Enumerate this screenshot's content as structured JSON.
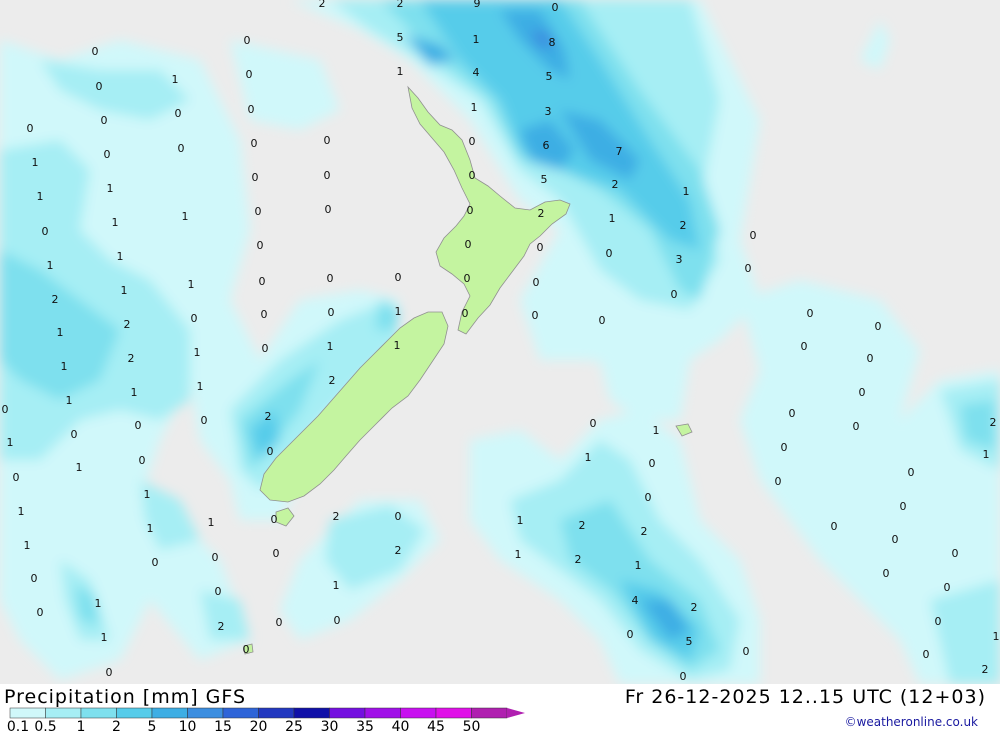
{
  "header": {
    "title": "Precipitation [mm] GFS",
    "datetime": "Fr 26-12-2025 12..15 UTC (12+03)"
  },
  "legend": {
    "ticks": [
      "0.1",
      "0.5",
      "1",
      "2",
      "5",
      "10",
      "15",
      "20",
      "25",
      "30",
      "35",
      "40",
      "45",
      "50"
    ],
    "colors": [
      "#d0f8fa",
      "#a6eef4",
      "#7ee0ee",
      "#56ccea",
      "#3eaee4",
      "#3c8ee0",
      "#2e64d8",
      "#2238c0",
      "#1010a8",
      "#7410e0",
      "#a010e8",
      "#c810f0",
      "#e010e8",
      "#b020b0"
    ]
  },
  "credit": "©weatheronline.co.uk",
  "map": {
    "colors": {
      "sea": "#ececec",
      "land": "#c4f4a0",
      "coast": "#909090"
    },
    "values": [
      [
        "2",
        322,
        3
      ],
      [
        "2",
        400,
        3
      ],
      [
        "9",
        477,
        3
      ],
      [
        "0",
        555,
        7
      ],
      [
        "0",
        95,
        51
      ],
      [
        "0",
        247,
        40
      ],
      [
        "5",
        400,
        37
      ],
      [
        "1",
        476,
        39
      ],
      [
        "8",
        552,
        42
      ],
      [
        "1",
        175,
        79
      ],
      [
        "0",
        249,
        74
      ],
      [
        "1",
        400,
        71
      ],
      [
        "4",
        476,
        72
      ],
      [
        "5",
        549,
        76
      ],
      [
        "0",
        99,
        86
      ],
      [
        "0",
        178,
        113
      ],
      [
        "0",
        251,
        109
      ],
      [
        "1",
        474,
        107
      ],
      [
        "3",
        548,
        111
      ],
      [
        "0",
        104,
        120
      ],
      [
        "0",
        30,
        128
      ],
      [
        "0",
        181,
        148
      ],
      [
        "0",
        254,
        143
      ],
      [
        "0",
        327,
        140
      ],
      [
        "0",
        472,
        141
      ],
      [
        "6",
        546,
        145
      ],
      [
        "7",
        619,
        151
      ],
      [
        "0",
        107,
        154
      ],
      [
        "1",
        35,
        162
      ],
      [
        "0",
        255,
        177
      ],
      [
        "0",
        327,
        175
      ],
      [
        "0",
        472,
        175
      ],
      [
        "5",
        544,
        179
      ],
      [
        "2",
        615,
        184
      ],
      [
        "1",
        110,
        188
      ],
      [
        "1",
        40,
        196
      ],
      [
        "0",
        258,
        211
      ],
      [
        "0",
        328,
        209
      ],
      [
        "0",
        470,
        210
      ],
      [
        "2",
        541,
        213
      ],
      [
        "1",
        612,
        218
      ],
      [
        "1",
        686,
        191
      ],
      [
        "1",
        185,
        216
      ],
      [
        "1",
        115,
        222
      ],
      [
        "0",
        45,
        231
      ],
      [
        "2",
        683,
        225
      ],
      [
        "0",
        753,
        235
      ],
      [
        "0",
        260,
        245
      ],
      [
        "0",
        468,
        244
      ],
      [
        "0",
        540,
        247
      ],
      [
        "0",
        609,
        253
      ],
      [
        "3",
        679,
        259
      ],
      [
        "0",
        748,
        268
      ],
      [
        "1",
        120,
        256
      ],
      [
        "1",
        50,
        265
      ],
      [
        "0",
        398,
        277
      ],
      [
        "0",
        330,
        278
      ],
      [
        "0",
        262,
        281
      ],
      [
        "0",
        467,
        278
      ],
      [
        "0",
        536,
        282
      ],
      [
        "1",
        191,
        284
      ],
      [
        "1",
        124,
        290
      ],
      [
        "2",
        55,
        299
      ],
      [
        "0",
        674,
        294
      ],
      [
        "0",
        194,
        318
      ],
      [
        "0",
        264,
        314
      ],
      [
        "0",
        331,
        312
      ],
      [
        "1",
        398,
        311
      ],
      [
        "0",
        465,
        313
      ],
      [
        "0",
        535,
        315
      ],
      [
        "0",
        602,
        320
      ],
      [
        "0",
        810,
        313
      ],
      [
        "2",
        127,
        324
      ],
      [
        "1",
        60,
        332
      ],
      [
        "0",
        878,
        326
      ],
      [
        "1",
        197,
        352
      ],
      [
        "0",
        265,
        348
      ],
      [
        "1",
        330,
        346
      ],
      [
        "1",
        397,
        345
      ],
      [
        "0",
        804,
        346
      ],
      [
        "2",
        131,
        358
      ],
      [
        "1",
        64,
        366
      ],
      [
        "0",
        870,
        358
      ],
      [
        "1",
        200,
        386
      ],
      [
        "1",
        134,
        392
      ],
      [
        "1",
        69,
        400
      ],
      [
        "2",
        332,
        380
      ],
      [
        "0",
        862,
        392
      ],
      [
        "0",
        204,
        420
      ],
      [
        "0",
        138,
        425
      ],
      [
        "0",
        74,
        434
      ],
      [
        "0",
        5,
        409
      ],
      [
        "2",
        268,
        416
      ],
      [
        "0",
        593,
        423
      ],
      [
        "1",
        656,
        430
      ],
      [
        "0",
        792,
        413
      ],
      [
        "0",
        856,
        426
      ],
      [
        "2",
        993,
        422
      ],
      [
        "0",
        270,
        451
      ],
      [
        "1",
        10,
        442
      ],
      [
        "0",
        142,
        460
      ],
      [
        "1",
        79,
        467
      ],
      [
        "1",
        588,
        457
      ],
      [
        "0",
        652,
        463
      ],
      [
        "0",
        784,
        447
      ],
      [
        "1",
        986,
        454
      ],
      [
        "0",
        16,
        477
      ],
      [
        "1",
        147,
        494
      ],
      [
        "0",
        648,
        497
      ],
      [
        "0",
        778,
        481
      ],
      [
        "0",
        911,
        472
      ],
      [
        "1",
        21,
        511
      ],
      [
        "1",
        211,
        522
      ],
      [
        "1",
        150,
        528
      ],
      [
        "0",
        274,
        519
      ],
      [
        "2",
        336,
        516
      ],
      [
        "0",
        398,
        516
      ],
      [
        "1",
        520,
        520
      ],
      [
        "2",
        582,
        525
      ],
      [
        "2",
        644,
        531
      ],
      [
        "0",
        903,
        506
      ],
      [
        "1",
        27,
        545
      ],
      [
        "0",
        155,
        562
      ],
      [
        "0",
        215,
        557
      ],
      [
        "0",
        276,
        553
      ],
      [
        "2",
        398,
        550
      ],
      [
        "1",
        518,
        554
      ],
      [
        "2",
        578,
        559
      ],
      [
        "1",
        638,
        565
      ],
      [
        "0",
        834,
        526
      ],
      [
        "0",
        895,
        539
      ],
      [
        "0",
        955,
        553
      ],
      [
        "0",
        34,
        578
      ],
      [
        "0",
        218,
        591
      ],
      [
        "1",
        336,
        585
      ],
      [
        "4",
        635,
        600
      ],
      [
        "2",
        694,
        607
      ],
      [
        "0",
        886,
        573
      ],
      [
        "0",
        947,
        587
      ],
      [
        "0",
        40,
        612
      ],
      [
        "1",
        98,
        603
      ],
      [
        "2",
        221,
        626
      ],
      [
        "0",
        279,
        622
      ],
      [
        "0",
        337,
        620
      ],
      [
        "0",
        630,
        634
      ],
      [
        "5",
        689,
        641
      ],
      [
        "0",
        938,
        621
      ],
      [
        "1",
        996,
        636
      ],
      [
        "1",
        104,
        637
      ],
      [
        "0",
        109,
        672
      ],
      [
        "0",
        246,
        649
      ],
      [
        "0",
        746,
        651
      ],
      [
        "0",
        926,
        654
      ],
      [
        "2",
        985,
        669
      ],
      [
        "0",
        683,
        676
      ]
    ]
  }
}
